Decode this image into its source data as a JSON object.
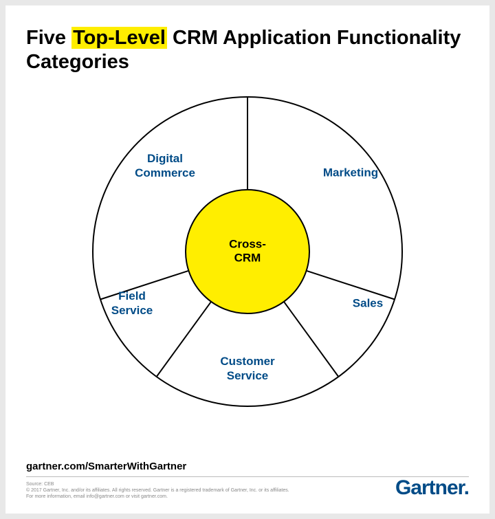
{
  "title": {
    "pre": "Five ",
    "highlight": "Top-Level",
    "post": " CRM Application Functionality Categories"
  },
  "diagram": {
    "center": "Cross-\nCRM",
    "segments": [
      {
        "label": "Marketing"
      },
      {
        "label": "Sales"
      },
      {
        "label": "Customer\nService"
      },
      {
        "label": "Field\nService"
      },
      {
        "label": "Digital\nCommerce"
      }
    ]
  },
  "footer": {
    "url": "gartner.com/SmarterWithGartner",
    "source": "Source: CEB",
    "copyright": "© 2017 Gartner, Inc. and/or its affiliates. All rights reserved. Gartner is a registered trademark of Gartner, Inc. or its affiliates.",
    "info": "For more information, email info@gartner.com or visit gartner.com.",
    "logo": "Gartner",
    "logo_dot": "."
  },
  "colors": {
    "highlight": "#ffee00",
    "segment_text": "#004b87",
    "center_fill": "#ffee00"
  }
}
